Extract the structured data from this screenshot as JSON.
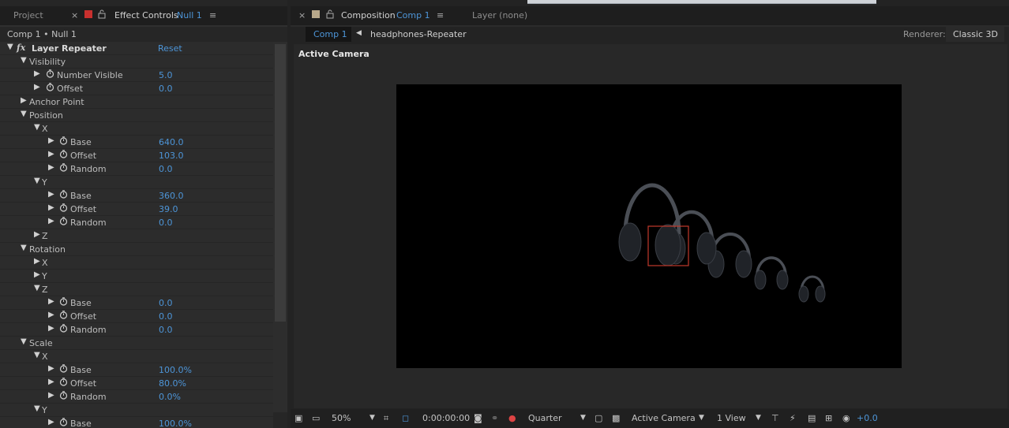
{
  "left_panel": {
    "tabs": [
      {
        "label": "Project"
      },
      {
        "label": "Effect Controls",
        "layer": "Null 1"
      }
    ],
    "breadcrumb": "Comp 1 • Null 1",
    "effect_name": "Layer Repeater",
    "reset_label": "Reset",
    "rows": [
      {
        "label": "Visibility",
        "indent": 1,
        "expanded": true,
        "stopwatch": false,
        "value": ""
      },
      {
        "label": "Number Visible",
        "indent": 3,
        "expanded": false,
        "stopwatch": true,
        "value": "5.0"
      },
      {
        "label": "Offset",
        "indent": 3,
        "expanded": false,
        "stopwatch": true,
        "value": "0.0"
      },
      {
        "label": "Anchor Point",
        "indent": 1,
        "expanded": false,
        "stopwatch": false,
        "value": ""
      },
      {
        "label": "Position",
        "indent": 1,
        "expanded": true,
        "stopwatch": false,
        "value": ""
      },
      {
        "label": "X",
        "indent": 2,
        "expanded": true,
        "stopwatch": false,
        "value": ""
      },
      {
        "label": "Base",
        "indent": 4,
        "expanded": false,
        "stopwatch": true,
        "value": "640.0"
      },
      {
        "label": "Offset",
        "indent": 4,
        "expanded": false,
        "stopwatch": true,
        "value": "103.0"
      },
      {
        "label": "Random",
        "indent": 4,
        "expanded": false,
        "stopwatch": true,
        "value": "0.0"
      },
      {
        "label": "Y",
        "indent": 2,
        "expanded": true,
        "stopwatch": false,
        "value": ""
      },
      {
        "label": "Base",
        "indent": 4,
        "expanded": false,
        "stopwatch": true,
        "value": "360.0"
      },
      {
        "label": "Offset",
        "indent": 4,
        "expanded": false,
        "stopwatch": true,
        "value": "39.0"
      },
      {
        "label": "Random",
        "indent": 4,
        "expanded": false,
        "stopwatch": true,
        "value": "0.0"
      },
      {
        "label": "Z",
        "indent": 2,
        "expanded": false,
        "stopwatch": false,
        "value": ""
      },
      {
        "label": "Rotation",
        "indent": 1,
        "expanded": true,
        "stopwatch": false,
        "value": ""
      },
      {
        "label": "X",
        "indent": 2,
        "expanded": false,
        "stopwatch": false,
        "value": ""
      },
      {
        "label": "Y",
        "indent": 2,
        "expanded": false,
        "stopwatch": false,
        "value": ""
      },
      {
        "label": "Z",
        "indent": 2,
        "expanded": true,
        "stopwatch": false,
        "value": ""
      },
      {
        "label": "Base",
        "indent": 4,
        "expanded": false,
        "stopwatch": true,
        "value": "0.0"
      },
      {
        "label": "Offset",
        "indent": 4,
        "expanded": false,
        "stopwatch": true,
        "value": "0.0"
      },
      {
        "label": "Random",
        "indent": 4,
        "expanded": false,
        "stopwatch": true,
        "value": "0.0"
      },
      {
        "label": "Scale",
        "indent": 1,
        "expanded": true,
        "stopwatch": false,
        "value": ""
      },
      {
        "label": "X",
        "indent": 2,
        "expanded": true,
        "stopwatch": false,
        "value": ""
      },
      {
        "label": "Base",
        "indent": 4,
        "expanded": false,
        "stopwatch": true,
        "value": "100.0%"
      },
      {
        "label": "Offset",
        "indent": 4,
        "expanded": false,
        "stopwatch": true,
        "value": "80.0%"
      },
      {
        "label": "Random",
        "indent": 4,
        "expanded": false,
        "stopwatch": true,
        "value": "0.0%"
      },
      {
        "label": "Y",
        "indent": 2,
        "expanded": true,
        "stopwatch": false,
        "value": ""
      },
      {
        "label": "Base",
        "indent": 4,
        "expanded": false,
        "stopwatch": true,
        "value": "100.0%"
      }
    ]
  },
  "right_panel": {
    "tabs": [
      {
        "label": "Composition",
        "name": "Comp 1"
      },
      {
        "label": "Layer (none)"
      }
    ],
    "comp_button": "Comp 1",
    "layer_path": "headphones-Repeater",
    "renderer_label": "Renderer:",
    "renderer_value": "Classic 3D",
    "active_camera": "Active Camera",
    "viewer_icons": [
      "headphones-icon"
    ]
  },
  "bottom_bar": {
    "zoom": "50%",
    "timecode": "0:00:00:00",
    "resolution": "Quarter",
    "view": "Active Camera",
    "layout": "1 View",
    "exposure": "+0.0"
  },
  "colors": {
    "accent": "#4d95d8",
    "panel": "#262626",
    "label_swatch": "#c8302e",
    "comp_swatch": "#b8a88a"
  }
}
